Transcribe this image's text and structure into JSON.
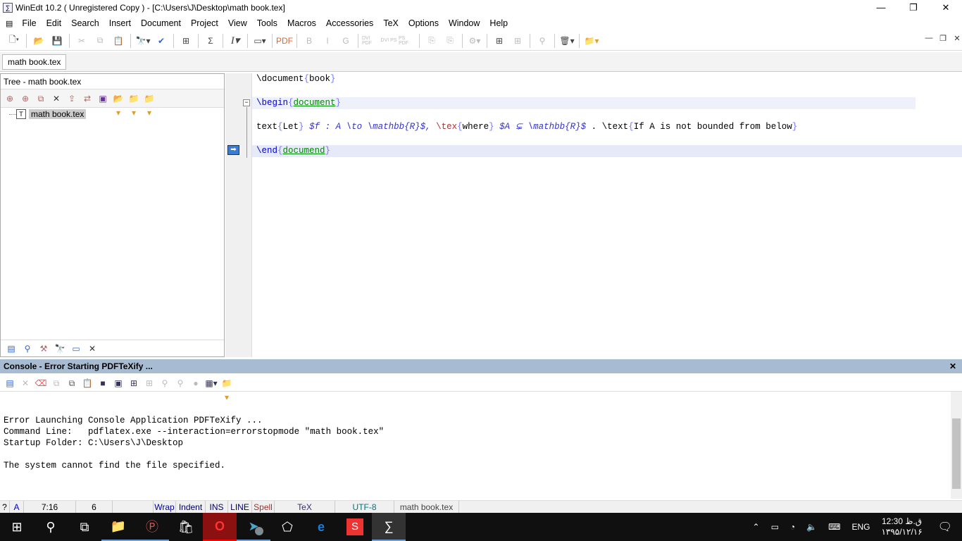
{
  "window": {
    "title": "WinEdt 10.2  ( Unregistered  Copy )  - [C:\\Users\\J\\Desktop\\math book.tex]",
    "minimize": "—",
    "restore": "❐",
    "close": "✕"
  },
  "menu": [
    "File",
    "Edit",
    "Search",
    "Insert",
    "Document",
    "Project",
    "View",
    "Tools",
    "Macros",
    "Accessories",
    "TeX",
    "Options",
    "Window",
    "Help"
  ],
  "toolbar": [
    "new-icon",
    "open-icon",
    "save-icon",
    "cut-icon",
    "copy-icon",
    "paste-icon",
    "find-icon",
    "spell-icon",
    "tree-icon",
    "sum-icon",
    "italic-icon",
    "image-icon",
    "pdf-icon",
    "bold-icon",
    "italic-letter-icon",
    "g-icon",
    "dvi-pdf-icon",
    "dvi-ps-icon",
    "ps-pdf-icon",
    "acrobat-icon",
    "acrobat2-icon",
    "settings-icon",
    "insert-icon",
    "insert2-icon",
    "search-icon",
    "delete-icon",
    "folder-icon"
  ],
  "tab": "math book.tex",
  "tree": {
    "title": "Tree - math book.tex",
    "item": "math book.tex"
  },
  "editor": {
    "l1": {
      "a": "\\document",
      "b": "{",
      "c": "book",
      "d": "}"
    },
    "l2": {
      "a": "\\begin",
      "b": "{",
      "c": "document",
      "d": "}"
    },
    "l3": {
      "a": "text",
      "b": "{",
      "c": "Let",
      "d": "}",
      "e": " $f : A \\to \\mathbb{R}$",
      "f": ", ",
      "g": "\\tex",
      "h": "{",
      "i": "where",
      "j": "}",
      "k": " $A ⊊ \\mathbb{R}$",
      "l": " . \\text",
      "m": "{",
      "n": "If A is not bounded from below",
      "o": "}"
    },
    "l4": {
      "a": "\\end",
      "b": "{",
      "c": "documend",
      "d": "}"
    }
  },
  "console": {
    "title": "Console - Error Starting PDFTeXify ...",
    "close": "✕",
    "text": "Error Launching Console Application PDFTeXify ...\nCommand Line:   pdflatex.exe --interaction=errorstopmode \"math book.tex\"\nStartup Folder: C:\\Users\\J\\Desktop\n\nThe system cannot find the file specified."
  },
  "status": {
    "help": "?",
    "a": "A",
    "pos": "7:16",
    "lines": "6",
    "wrap": "Wrap",
    "indent": "Indent",
    "ins": "INS",
    "line": "LINE",
    "spell": "Spell",
    "mode": "TeX",
    "enc": "UTF-8",
    "file": "math book.tex"
  },
  "taskbar": {
    "lang": "ENG",
    "time": "12:30 ق.ظ",
    "date": "۱۳۹۵/۱۲/۱۶",
    "telegram_badge": "2"
  }
}
